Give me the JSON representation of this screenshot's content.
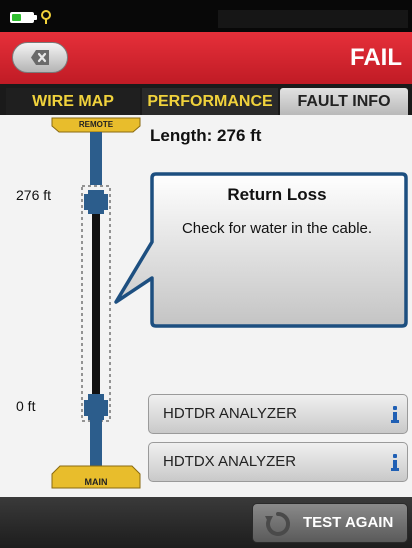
{
  "header": {
    "status": "FAIL",
    "back_icon": "close-x-icon"
  },
  "tabs": [
    {
      "label": "WIRE MAP"
    },
    {
      "label": "PERFORMANCE"
    },
    {
      "label": "FAULT INFO",
      "selected": true
    }
  ],
  "cable": {
    "remote_label": "REMOTE",
    "main_label": "MAIN",
    "length_text": "Length: 276 ft",
    "far_end_label": "276 ft",
    "near_end_label": "0 ft"
  },
  "fault": {
    "title": "Return Loss",
    "message": "Check for water in the cable."
  },
  "analyzers": [
    {
      "label": "HDTDR ANALYZER",
      "icon": "info-icon"
    },
    {
      "label": "HDTDX ANALYZER",
      "icon": "info-icon"
    }
  ],
  "footer": {
    "test_again_label": "TEST AGAIN",
    "icon": "refresh-icon"
  },
  "colors": {
    "header_red": "#d4232d",
    "tab_yellow": "#f0d23c",
    "cable_blue": "#2c5d8c",
    "info_blue": "#1f5fb4"
  }
}
